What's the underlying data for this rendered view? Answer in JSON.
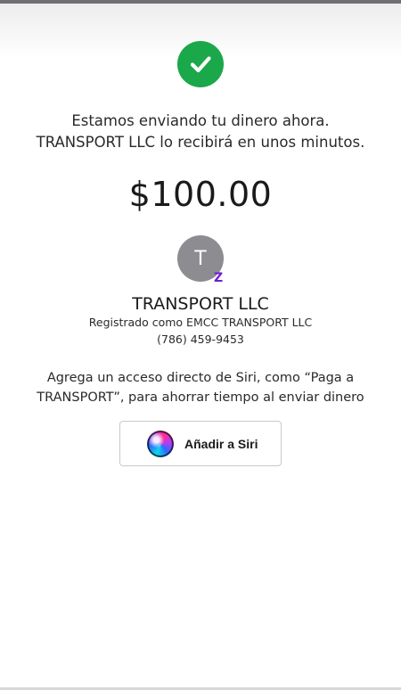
{
  "confirmation": {
    "line1": "Estamos enviando tu dinero ahora.",
    "line2": "TRANSPORT LLC lo recibirá en unos minutos.",
    "amount": "$100.00",
    "success_icon": "check-circle-icon",
    "success_color": "#1aa84a"
  },
  "recipient": {
    "initial": "T",
    "name": "TRANSPORT LLC",
    "registered_as": "Registrado como EMCC TRANSPORT LLC",
    "phone": "(786) 459-9453",
    "badge_letter": "Z",
    "badge_color": "#6d1ed4"
  },
  "siri": {
    "note_line1": "Agrega un acceso directo de Siri, como “Paga a",
    "note_line2": "TRANSPORT”, para ahorrar tiempo al enviar dinero",
    "button_label": "Añadir a Siri",
    "button_icon": "siri-icon"
  }
}
